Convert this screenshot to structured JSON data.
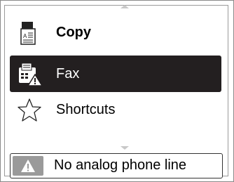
{
  "menu": {
    "items": [
      {
        "label": "Copy",
        "icon": "copy-document-icon",
        "selected": false
      },
      {
        "label": "Fax",
        "icon": "fax-warning-icon",
        "selected": true
      },
      {
        "label": "Shortcuts",
        "icon": "star-outline-icon",
        "selected": false
      }
    ]
  },
  "status": {
    "message": "No analog phone line",
    "icon": "warning-icon"
  },
  "colors": {
    "selected_bg": "#231f20",
    "warning_box": "#9a9a9a"
  }
}
